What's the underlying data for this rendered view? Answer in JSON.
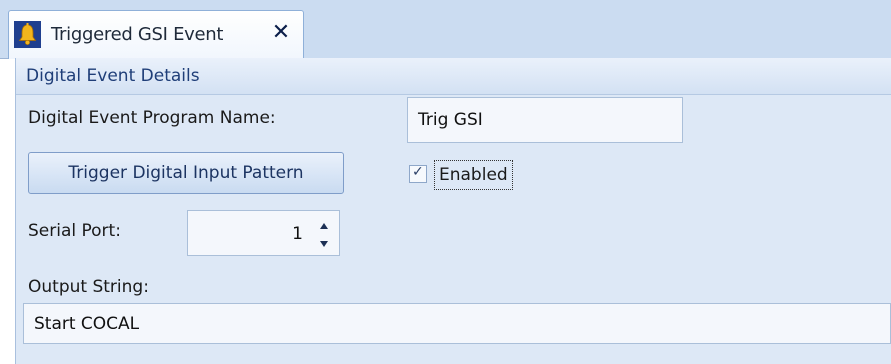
{
  "tab": {
    "title": "Triggered GSI Event",
    "icon": "bell-icon",
    "close_icon": "close-icon"
  },
  "group": {
    "title": "Digital Event Details"
  },
  "program_name": {
    "label": "Digital Event Program Name:",
    "value": "Trig GSI"
  },
  "trigger_button": {
    "label": "Trigger Digital Input Pattern"
  },
  "enabled": {
    "label": "Enabled",
    "checked": true
  },
  "serial_port": {
    "label": "Serial Port:",
    "value": "1"
  },
  "output_string": {
    "label": "Output String:",
    "value": "Start COCAL"
  },
  "colors": {
    "tab_strip": "#cbdcf1",
    "panel": "#dde8f6",
    "header_text": "#1f3e78"
  }
}
